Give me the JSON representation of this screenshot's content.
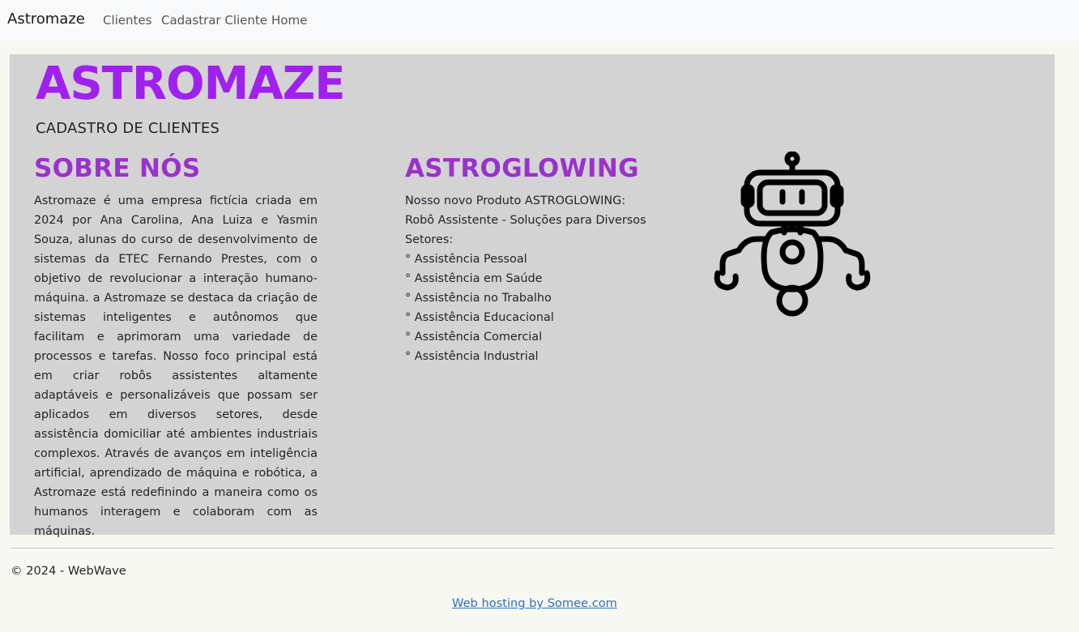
{
  "navbar": {
    "brand": "Astromaze",
    "links": [
      "Clientes",
      "Cadastrar Cliente",
      "Home"
    ]
  },
  "hero": {
    "title": "ASTROMAZE",
    "subtitle": "CADASTRO DE CLIENTES"
  },
  "about": {
    "title": "SOBRE NÓS",
    "text": "Astromaze é uma empresa fictícia criada em 2024 por Ana Carolina, Ana Luiza e Yasmin Souza, alunas do curso de desenvolvimento de sistemas da ETEC Fernando Prestes, com o objetivo de revolucionar a interação humano-máquina. a Astromaze se destaca da criação de sistemas inteligentes e autônomos que facilitam e aprimoram uma variedade de processos e tarefas. Nosso foco principal está em criar robôs assistentes altamente adaptáveis e personalizáveis que possam ser aplicados em diversos setores, desde assistência domiciliar até ambientes industriais complexos. Através de avanços em inteligência artificial, aprendizado de máquina e robótica, a Astromaze está redefinindo a maneira como os humanos interagem e colaboram com as máquinas."
  },
  "product": {
    "title": "ASTROGLOWING",
    "intro": "Nosso novo Produto ASTROGLOWING: Robô Assistente - Soluções para Diversos Setores:",
    "items": [
      "° Assistência Pessoal",
      "° Assistência em Saúde",
      "° Assistência no Trabalho",
      "° Assistência Educacional",
      "° Assistência Comercial",
      "° Assistência Industrial"
    ],
    "image_icon": "robot-icon"
  },
  "footer": {
    "copyright": "© 2024 - WebWave",
    "hosting_link": "Web hosting by Somee.com"
  },
  "colors": {
    "title_purple": "#a020f0",
    "section_purple": "#9932cc",
    "jumbotron_bg": "#d3d3d3",
    "link_blue": "#2a6fc9"
  }
}
